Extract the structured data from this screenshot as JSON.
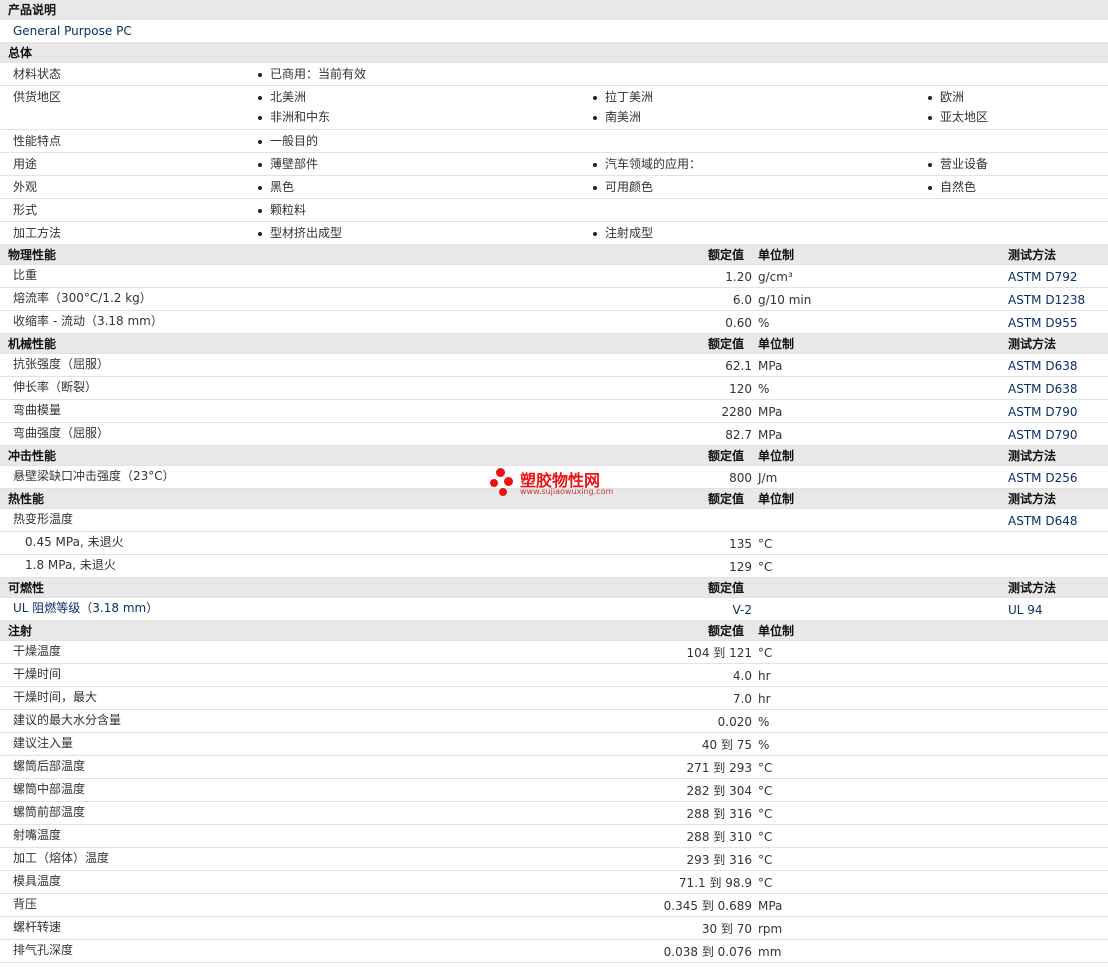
{
  "sections": [
    {
      "kind": "header",
      "label": "产品说明"
    },
    {
      "kind": "desc",
      "text": "General Purpose PC"
    },
    {
      "kind": "header",
      "label": "总体"
    },
    {
      "kind": "general",
      "label": "材料状态",
      "items": [
        "已商用：当前有效"
      ]
    },
    {
      "kind": "general",
      "label": "供货地区",
      "items": [
        "北美洲",
        "拉丁美洲",
        "欧洲",
        "非洲和中东",
        "南美洲",
        "亚太地区"
      ]
    },
    {
      "kind": "general",
      "label": "性能特点",
      "items": [
        "一般目的"
      ]
    },
    {
      "kind": "general",
      "label": "用途",
      "items": [
        "薄壁部件",
        "汽车领域的应用：",
        "营业设备"
      ]
    },
    {
      "kind": "general",
      "label": "外观",
      "items": [
        "黑色",
        "可用颜色",
        "自然色"
      ]
    },
    {
      "kind": "general",
      "label": "形式",
      "items": [
        "颗粒料"
      ]
    },
    {
      "kind": "general",
      "label": "加工方法",
      "items": [
        "型材挤出成型",
        "注射成型"
      ]
    },
    {
      "kind": "header",
      "label": "物理性能",
      "c1": "额定值",
      "c2": "单位制",
      "c3": "测试方法"
    },
    {
      "kind": "data",
      "name": "比重",
      "value": "1.20",
      "unit": "g/cm³",
      "method": "ASTM D792"
    },
    {
      "kind": "data",
      "name": "熔流率（300°C/1.2 kg）",
      "value": "6.0",
      "unit": "g/10 min",
      "method": "ASTM D1238"
    },
    {
      "kind": "data",
      "name": "收缩率 - 流动（3.18 mm）",
      "value": "0.60",
      "unit": "%",
      "method": "ASTM D955"
    },
    {
      "kind": "header",
      "label": "机械性能",
      "c1": "额定值",
      "c2": "单位制",
      "c3": "测试方法"
    },
    {
      "kind": "data",
      "name": "抗张强度（屈服）",
      "value": "62.1",
      "unit": "MPa",
      "method": "ASTM D638"
    },
    {
      "kind": "data",
      "name": "伸长率（断裂）",
      "value": "120",
      "unit": "%",
      "method": "ASTM D638"
    },
    {
      "kind": "data",
      "name": "弯曲模量",
      "value": "2280",
      "unit": "MPa",
      "method": "ASTM D790"
    },
    {
      "kind": "data",
      "name": "弯曲强度（屈服）",
      "value": "82.7",
      "unit": "MPa",
      "method": "ASTM D790"
    },
    {
      "kind": "header",
      "label": "冲击性能",
      "c1": "额定值",
      "c2": "单位制",
      "c3": "测试方法"
    },
    {
      "kind": "data",
      "name": "悬壁梁缺口冲击强度（23°C）",
      "value": "800",
      "unit": "J/m",
      "method": "ASTM D256"
    },
    {
      "kind": "header",
      "label": "热性能",
      "c1": "额定值",
      "c2": "单位制",
      "c3": "测试方法"
    },
    {
      "kind": "data",
      "name": "热变形温度",
      "value": "",
      "unit": "",
      "method": "ASTM D648"
    },
    {
      "kind": "data",
      "name": "0.45 MPa, 未退火",
      "value": "135",
      "unit": "°C",
      "method": "",
      "indent": true
    },
    {
      "kind": "data",
      "name": "1.8 MPa, 未退火",
      "value": "129",
      "unit": "°C",
      "method": "",
      "indent": true
    },
    {
      "kind": "header",
      "label": "可燃性",
      "c1": "额定值",
      "c2": "",
      "c3": "测试方法"
    },
    {
      "kind": "data",
      "name": "UL 阻燃等级（3.18 mm）",
      "value": "V-2",
      "unit": "",
      "method": "UL 94",
      "blue": true
    },
    {
      "kind": "header",
      "label": "注射",
      "c1": "额定值",
      "c2": "单位制",
      "c3": ""
    },
    {
      "kind": "data",
      "name": "干燥温度",
      "value": "104 到  121",
      "unit": "°C",
      "method": ""
    },
    {
      "kind": "data",
      "name": "干燥时间",
      "value": "4.0",
      "unit": "hr",
      "method": ""
    },
    {
      "kind": "data",
      "name": "干燥时间，最大",
      "value": "7.0",
      "unit": "hr",
      "method": ""
    },
    {
      "kind": "data",
      "name": "建议的最大水分含量",
      "value": "0.020",
      "unit": "%",
      "method": ""
    },
    {
      "kind": "data",
      "name": "建议注入量",
      "value": "40 到  75",
      "unit": "%",
      "method": ""
    },
    {
      "kind": "data",
      "name": "螺筒后部温度",
      "value": "271 到  293",
      "unit": "°C",
      "method": ""
    },
    {
      "kind": "data",
      "name": "螺筒中部温度",
      "value": "282 到  304",
      "unit": "°C",
      "method": ""
    },
    {
      "kind": "data",
      "name": "螺筒前部温度",
      "value": "288 到  316",
      "unit": "°C",
      "method": ""
    },
    {
      "kind": "data",
      "name": "射嘴温度",
      "value": "288 到  310",
      "unit": "°C",
      "method": ""
    },
    {
      "kind": "data",
      "name": "加工（熔体）温度",
      "value": "293 到  316",
      "unit": "°C",
      "method": ""
    },
    {
      "kind": "data",
      "name": "模具温度",
      "value": "71.1 到  98.9",
      "unit": "°C",
      "method": ""
    },
    {
      "kind": "data",
      "name": "背压",
      "value": "0.345 到  0.689",
      "unit": "MPa",
      "method": ""
    },
    {
      "kind": "data",
      "name": "螺杆转速",
      "value": "30 到  70",
      "unit": "rpm",
      "method": ""
    },
    {
      "kind": "data",
      "name": "排气孔深度",
      "value": "0.038 到  0.076",
      "unit": "mm",
      "method": ""
    }
  ],
  "watermark": {
    "title": "塑胶物性网",
    "url": "www.sujiaowuxing.com",
    "color": "#e11111"
  }
}
